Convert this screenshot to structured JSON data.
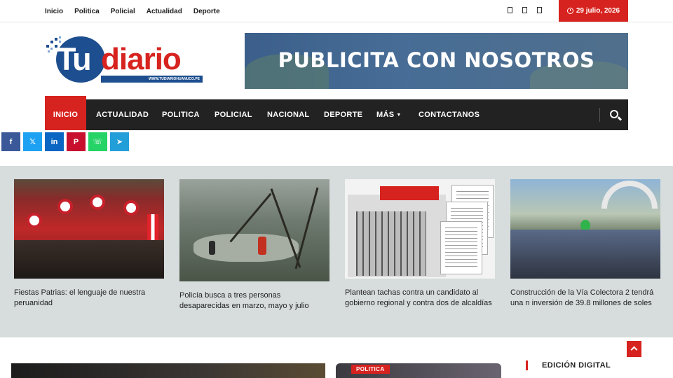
{
  "topbar": {
    "nav": [
      "Inicio",
      "Politica",
      "Policial",
      "Actualidad",
      "Deporte"
    ],
    "date": "29 julio, 2026"
  },
  "logo": {
    "tu": "Tu",
    "diario": "diario",
    "url": "WWW.TUDIARIOHUANUCO.PE"
  },
  "ad": {
    "text": "PUBLICITA  CON NOSOTROS"
  },
  "mainnav": {
    "items": [
      "INICIO",
      "ACTUALIDAD",
      "POLITICA",
      "POLICIAL",
      "NACIONAL",
      "DEPORTE",
      "MÁS",
      "CONTACTANOS"
    ]
  },
  "share": {
    "facebook": "f",
    "x": "𝕏",
    "linkedin": "in",
    "pinterest": "P",
    "whatsapp": "☏",
    "telegram": "➤"
  },
  "featured": [
    {
      "title": "Fiestas Patrias: el lenguaje de nuestra peruanidad"
    },
    {
      "title": "Policía busca a tres personas desaparecidas en marzo, mayo y julio"
    },
    {
      "title": "Plantean tachas contra un candidato al gobierno regional y contra dos de alcaldías"
    },
    {
      "title": "Construcción de la Vía Colectora 2 tendrá una n inversión de 39.8 millones de soles"
    }
  ],
  "bottom": {
    "badge": "POLITICA",
    "edicion": "EDICIÓN DIGITAL"
  },
  "colors": {
    "accent": "#d7231f",
    "brand_blue": "#1d4e8f",
    "nav_bg": "#222222",
    "strip_bg": "#d7dcdd"
  }
}
